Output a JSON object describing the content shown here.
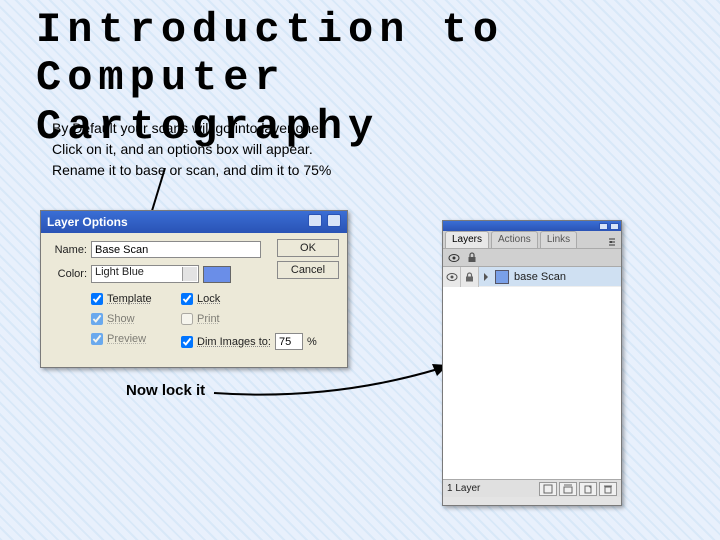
{
  "title": "Introduction to Computer Cartography",
  "body": {
    "line1": "By Default your scans will go into layer one",
    "line2": "Click on it, and an options box will appear.",
    "line3": "Rename it to base or scan, and dim it to 75%"
  },
  "caption": "Now lock it",
  "dialog": {
    "title": "Layer Options",
    "name_label": "Name:",
    "name_value": "Base Scan",
    "color_label": "Color:",
    "color_value": "Light Blue",
    "ok": "OK",
    "cancel": "Cancel",
    "checks": {
      "template": "Template",
      "lock": "Lock",
      "show": "Show",
      "print": "Print",
      "preview": "Preview",
      "dim_label": "Dim Images to:",
      "dim_value": "75",
      "percent": "%"
    }
  },
  "panel": {
    "tab1": "Layers",
    "tab2": "Actions",
    "tab3": "Links",
    "layer_name": "base Scan",
    "status": "1 Layer"
  }
}
